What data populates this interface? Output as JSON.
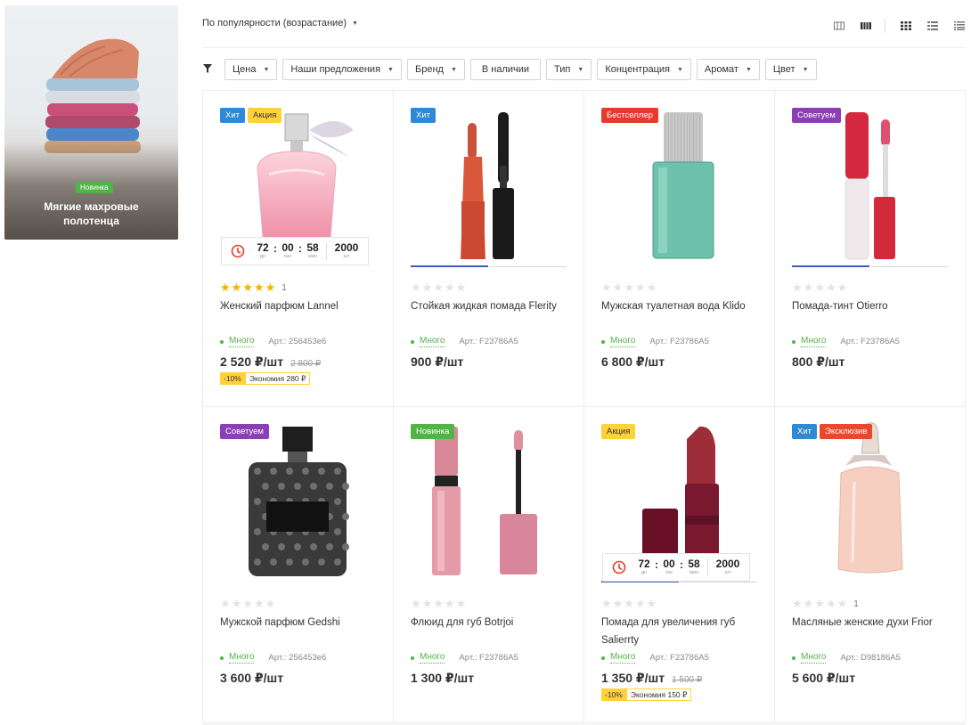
{
  "promo": {
    "badge": "Новинка",
    "title": "Мягкие махровые полотенца"
  },
  "sort": {
    "label": "По популярности (возрастание)",
    "caret_icon": "chevron-down-icon"
  },
  "view_icons": [
    "grid-large-icon",
    "grid-wide-icon",
    "grid-small-icon",
    "list-icon",
    "table-icon"
  ],
  "filters": [
    "Цена",
    "Наши предложения",
    "Бренд",
    "В наличии",
    "Тип",
    "Концентрация",
    "Аромат",
    "Цвет"
  ],
  "colors": {
    "hit": "#2e8ad4",
    "sale": "#ffd23a",
    "bestseller": "#e53b2e",
    "recommend": "#8b3fb3",
    "new": "#51b447",
    "exclusive": "#e8482e",
    "star": "#f5b000",
    "stock": "#51b447",
    "accent": "#3b5fb5"
  },
  "timer_units": {
    "days": "дн",
    "hours": "час",
    "minutes": "мин",
    "qty": "шт"
  },
  "products": [
    {
      "name": "Женский парфюм Lannel",
      "badges": [
        {
          "text": "Хит",
          "type": "hit"
        },
        {
          "text": "Акция",
          "type": "sale"
        }
      ],
      "rating": 5,
      "reviews": "1",
      "stock": "Много",
      "article": "Арт.: 256453e6",
      "price": "2 520 ₽/шт",
      "old_price": "2 800 ₽",
      "discount": "-10%",
      "economy": "Экономия 280 ₽",
      "timer": {
        "days": "72",
        "hours": "00",
        "minutes": "58",
        "qty": "2000"
      },
      "image": "perfume-pink",
      "gallery": null
    },
    {
      "name": "Стойкая жидкая помада Flerity",
      "badges": [
        {
          "text": "Хит",
          "type": "hit"
        }
      ],
      "rating": 0,
      "reviews": "",
      "stock": "Много",
      "article": "Арт.: F23786A5",
      "price": "900 ₽/шт",
      "old_price": "",
      "discount": "",
      "economy": "",
      "timer": null,
      "image": "lip-liquid-red",
      "gallery": 2
    },
    {
      "name": "Мужская туалетная вода Klido",
      "badges": [
        {
          "text": "Бестселлер",
          "type": "bestseller"
        }
      ],
      "rating": 0,
      "reviews": "",
      "stock": "Много",
      "article": "Арт.: F23786A5",
      "price": "6 800 ₽/шт",
      "old_price": "",
      "discount": "",
      "economy": "",
      "timer": null,
      "image": "perfume-green",
      "gallery": null
    },
    {
      "name": "Помада-тинт Otierro",
      "badges": [
        {
          "text": "Советуем",
          "type": "recommend"
        }
      ],
      "rating": 0,
      "reviews": "",
      "stock": "Много",
      "article": "Арт.: F23786A5",
      "price": "800 ₽/шт",
      "old_price": "",
      "discount": "",
      "economy": "",
      "timer": null,
      "image": "lip-tint-red",
      "gallery": 2
    },
    {
      "name": "Мужской парфюм Gedshi",
      "badges": [
        {
          "text": "Советуем",
          "type": "recommend"
        }
      ],
      "rating": 0,
      "reviews": "",
      "stock": "Много",
      "article": "Арт.: 256453e6",
      "price": "3 600 ₽/шт",
      "old_price": "",
      "discount": "",
      "economy": "",
      "timer": null,
      "image": "perfume-black",
      "gallery": null
    },
    {
      "name": "Флюид для губ Botrjoi",
      "badges": [
        {
          "text": "Новинка",
          "type": "new"
        }
      ],
      "rating": 0,
      "reviews": "",
      "stock": "Много",
      "article": "Арт.: F23786A5",
      "price": "1 300 ₽/шт",
      "old_price": "",
      "discount": "",
      "economy": "",
      "timer": null,
      "image": "lip-fluid-pink",
      "gallery": null
    },
    {
      "name": "Помада для увеличения губ Salierrty",
      "badges": [
        {
          "text": "Акция",
          "type": "sale"
        }
      ],
      "rating": 0,
      "reviews": "",
      "stock": "Много",
      "article": "Арт.: F23786A5",
      "price": "1 350 ₽/шт",
      "old_price": "1 500 ₽",
      "discount": "-10%",
      "economy": "Экономия 150 ₽",
      "timer": {
        "days": "72",
        "hours": "00",
        "minutes": "58",
        "qty": "2000"
      },
      "image": "lipstick-burgundy",
      "gallery": 2
    },
    {
      "name": "Масляные женские духи Frior",
      "badges": [
        {
          "text": "Хит",
          "type": "hit"
        },
        {
          "text": "Эксклюзив",
          "type": "exclusive"
        }
      ],
      "rating": 0,
      "reviews": "1",
      "stock": "Много",
      "article": "Арт.: D98186A5",
      "price": "5 600 ₽/шт",
      "old_price": "",
      "discount": "",
      "economy": "",
      "timer": null,
      "image": "perfume-peach",
      "gallery": null
    }
  ]
}
